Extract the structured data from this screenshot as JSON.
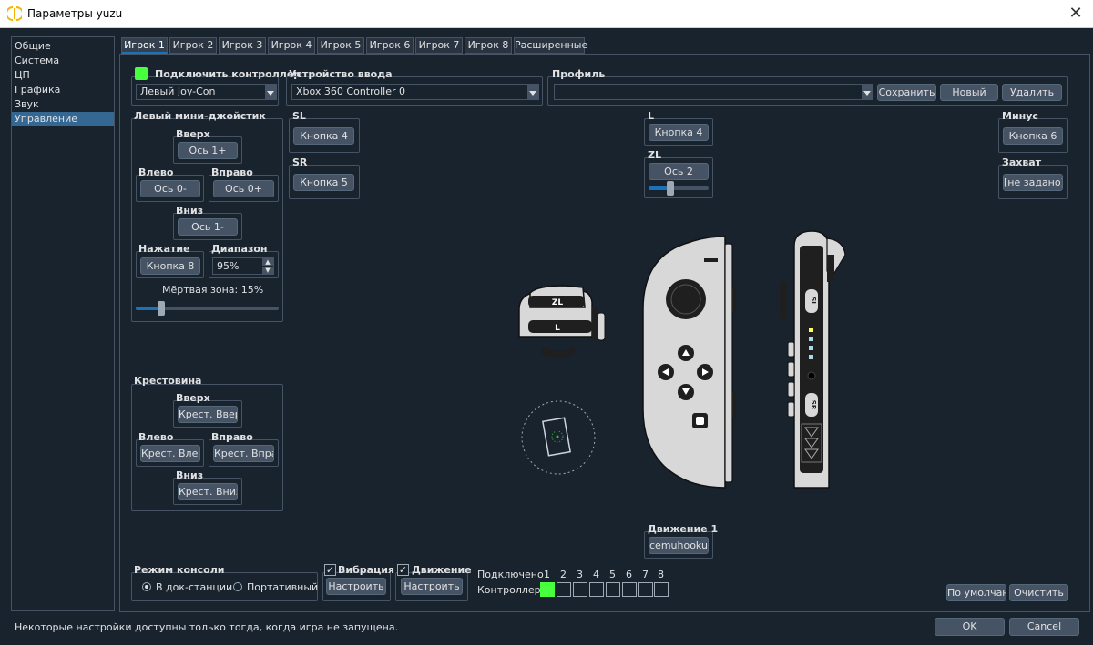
{
  "window": {
    "title": "Параметры yuzu",
    "close_icon": "close-icon",
    "app_icon": "yuzu-logo-icon"
  },
  "sidebar": {
    "items": [
      {
        "label": "Общие"
      },
      {
        "label": "Система"
      },
      {
        "label": "ЦП"
      },
      {
        "label": "Графика"
      },
      {
        "label": "Звук"
      },
      {
        "label": "Управление",
        "selected": true
      }
    ]
  },
  "tabs": [
    "Игрок 1",
    "Игрок 2",
    "Игрок 3",
    "Игрок 4",
    "Игрок 5",
    "Игрок 6",
    "Игрок 7",
    "Игрок 8",
    "Расширенные"
  ],
  "connect": {
    "label": "Подключить контроллер",
    "checked": true,
    "color": "#47ff3d",
    "type_value": "Левый Joy-Con"
  },
  "input_device": {
    "label": "Устройство ввода",
    "value": "Xbox 360 Controller 0"
  },
  "profile": {
    "label": "Профиль",
    "value": "",
    "save": "Сохранить",
    "new": "Новый",
    "delete": "Удалить"
  },
  "stick": {
    "title": "Левый мини-джойстик",
    "up_label": "Вверх",
    "up": "Ось 1+",
    "left_label": "Влево",
    "left": "Ось 0-",
    "right_label": "Вправо",
    "right": "Ось 0+",
    "down_label": "Вниз",
    "down": "Ось 1-",
    "press_label": "Нажатие",
    "press": "Кнопка 8",
    "range_label": "Диапазон",
    "range": "95%",
    "deadzone_label": "Мёртвая зона: 15%",
    "deadzone": 15
  },
  "sl": {
    "label": "SL",
    "value": "Кнопка 4"
  },
  "sr": {
    "label": "SR",
    "value": "Кнопка 5"
  },
  "l": {
    "label": "L",
    "value": "Кнопка 4"
  },
  "zl": {
    "label": "ZL",
    "value": "Ось 2",
    "slider": 30
  },
  "minus": {
    "label": "Минус",
    "value": "Кнопка 6"
  },
  "capture": {
    "label": "Захват",
    "value": "[не задано]"
  },
  "dpad": {
    "title": "Крестовина",
    "up_label": "Вверх",
    "up": "Крест. Вверх",
    "left_label": "Влево",
    "left": "Крест. Влево",
    "right_label": "Вправо",
    "right": "Крест. Вправо",
    "down_label": "Вниз",
    "down": "Крест. Вниз"
  },
  "motion": {
    "label": "Движение 1",
    "value": "cemuhookudp"
  },
  "illustration": {
    "zl": "ZL",
    "l": "L",
    "sl": "SL",
    "sr": "SR"
  },
  "console_mode": {
    "title": "Режим консоли",
    "docked": "В док-станции",
    "handheld": "Портативный",
    "selected": "docked"
  },
  "vibration": {
    "label": "Вибрация",
    "checked": true,
    "button": "Настроить"
  },
  "motion_group": {
    "label": "Движение",
    "checked": true,
    "button": "Настроить"
  },
  "connected": {
    "label1": "Подключено",
    "label2": "Контроллеры",
    "numbers": [
      "1",
      "2",
      "3",
      "4",
      "5",
      "6",
      "7",
      "8"
    ],
    "active": [
      true,
      false,
      false,
      false,
      false,
      false,
      false,
      false
    ]
  },
  "defaults_button": "По умолчанию",
  "clear_button": "Очистить",
  "footer": {
    "note": "Некоторые настройки доступны только тогда, когда игра не запущена.",
    "ok": "OK",
    "cancel": "Cancel"
  }
}
